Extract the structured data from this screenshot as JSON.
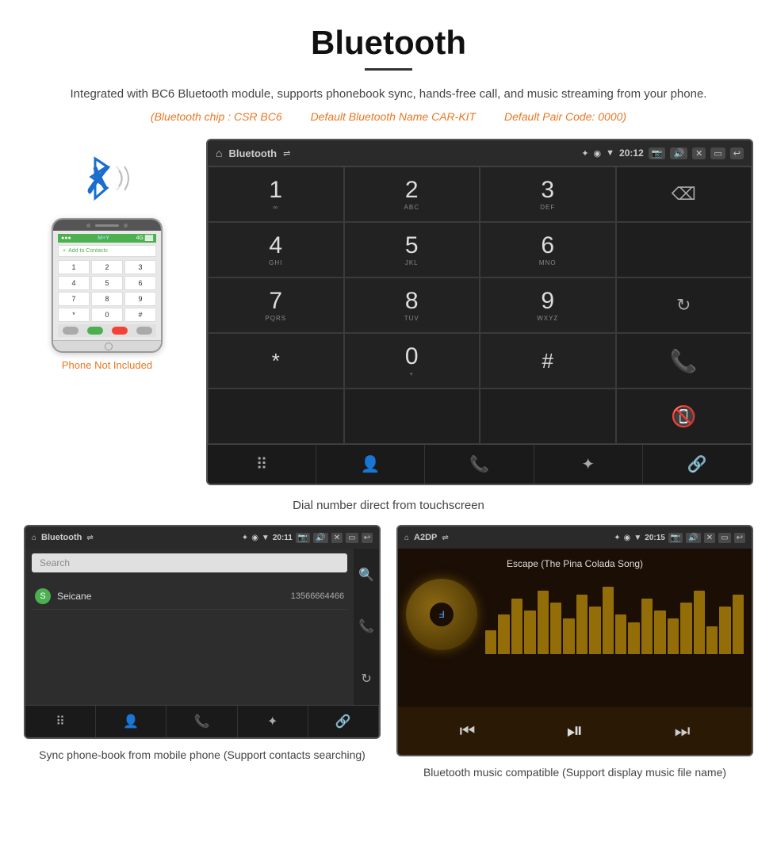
{
  "header": {
    "title": "Bluetooth",
    "description": "Integrated with BC6 Bluetooth module, supports phonebook sync, hands-free call, and music streaming from your phone.",
    "specs": {
      "chip": "(Bluetooth chip : CSR BC6",
      "name": "Default Bluetooth Name CAR-KIT",
      "code": "Default Pair Code: 0000)"
    }
  },
  "phone_label": "Phone Not Included",
  "dialpad_title": "Bluetooth",
  "dialpad_time": "20:12",
  "dialpad_keys": [
    {
      "number": "1",
      "letters": "∞"
    },
    {
      "number": "2",
      "letters": "ABC"
    },
    {
      "number": "3",
      "letters": "DEF"
    },
    {
      "number": "4",
      "letters": "GHI"
    },
    {
      "number": "5",
      "letters": "JKL"
    },
    {
      "number": "6",
      "letters": "MNO"
    },
    {
      "number": "7",
      "letters": "PQRS"
    },
    {
      "number": "8",
      "letters": "TUV"
    },
    {
      "number": "9",
      "letters": "WXYZ"
    },
    {
      "number": "*",
      "letters": ""
    },
    {
      "number": "0",
      "letters": "+"
    },
    {
      "number": "#",
      "letters": ""
    }
  ],
  "dialpad_caption": "Dial number direct from touchscreen",
  "phonebook": {
    "title": "Bluetooth",
    "time": "20:11",
    "search_placeholder": "Search",
    "contact_name": "Seicane",
    "contact_phone": "13566664466"
  },
  "music": {
    "title": "A2DP",
    "time": "20:15",
    "song_title": "Escape (The Pina Colada Song)"
  },
  "caption_phonebook": "Sync phone-book from mobile phone\n(Support contacts searching)",
  "caption_music": "Bluetooth music compatible\n(Support display music file name)",
  "eq_heights": [
    30,
    50,
    70,
    55,
    80,
    65,
    45,
    75,
    60,
    85,
    50,
    40,
    70,
    55,
    45,
    65,
    80,
    35,
    60,
    75
  ]
}
